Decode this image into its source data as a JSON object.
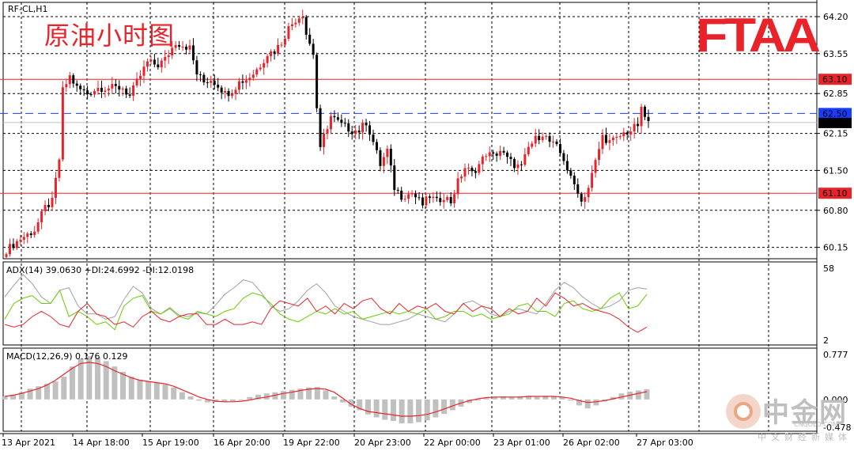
{
  "symbol_label": "RF-CL,H1",
  "title_cn": "原油小时图",
  "logo_text": "FTAA",
  "watermark": {
    "cn": "中金网",
    "url": "CNGOLD.COM",
    "sub": "中文财经新媒体"
  },
  "colors": {
    "red": "#e8242a",
    "blue": "#1a3cff",
    "green": "#66cc00",
    "gray": "#a0a0a0",
    "grid": "#000000"
  },
  "chart_data": [
    {
      "type": "candlestick",
      "name": "price",
      "ylim": [
        59.95,
        64.45
      ],
      "y_ticks": [
        "64.20",
        "63.55",
        "62.85",
        "62.15",
        "61.50",
        "60.80",
        "60.15"
      ],
      "y_tick_values": [
        64.2,
        63.55,
        62.85,
        62.15,
        61.5,
        60.8,
        60.15
      ],
      "x_ticks": [
        "13 Apr 2021",
        "14 Apr 18:00",
        "15 Apr 19:00",
        "16 Apr 20:00",
        "19 Apr 22:00",
        "20 Apr 23:00",
        "22 Apr 00:00",
        "23 Apr 01:00",
        "26 Apr 02:00",
        "27 Apr 03:00"
      ],
      "horizontal_lines": [
        {
          "value": 63.1,
          "label": "63.10",
          "style": "solid",
          "color": "#e8242a"
        },
        {
          "value": 62.5,
          "label": "62.50",
          "style": "dashed",
          "color": "#1a3cff"
        },
        {
          "value": 61.1,
          "label": "61.10",
          "style": "solid",
          "color": "#e8242a"
        }
      ],
      "current_price": {
        "value": 62.34,
        "label": "62.34"
      },
      "close_path": [
        [
          0,
          60.1
        ],
        [
          4,
          60.3
        ],
        [
          8,
          60.45
        ],
        [
          11,
          60.85
        ],
        [
          13,
          60.95
        ],
        [
          15,
          61.7
        ],
        [
          16,
          62.9
        ],
        [
          18,
          63.15
        ],
        [
          20,
          62.95
        ],
        [
          23,
          62.85
        ],
        [
          26,
          62.95
        ],
        [
          30,
          62.95
        ],
        [
          33,
          62.95
        ],
        [
          35,
          62.8
        ],
        [
          37,
          63.05
        ],
        [
          40,
          63.4
        ],
        [
          43,
          63.35
        ],
        [
          45,
          63.45
        ],
        [
          48,
          63.75
        ],
        [
          50,
          63.7
        ],
        [
          52,
          63.65
        ],
        [
          54,
          63.2
        ],
        [
          56,
          63.05
        ],
        [
          58,
          63.1
        ],
        [
          60,
          63.0
        ],
        [
          62,
          62.85
        ],
        [
          64,
          62.9
        ],
        [
          66,
          63.05
        ],
        [
          68,
          63.1
        ],
        [
          70,
          63.2
        ],
        [
          72,
          63.35
        ],
        [
          74,
          63.55
        ],
        [
          76,
          63.6
        ],
        [
          78,
          63.75
        ],
        [
          80,
          64.0
        ],
        [
          82,
          64.15
        ],
        [
          84,
          64.25
        ],
        [
          85,
          63.9
        ],
        [
          87,
          63.55
        ],
        [
          88,
          62.6
        ],
        [
          89,
          61.85
        ],
        [
          90,
          62.1
        ],
        [
          92,
          62.45
        ],
        [
          95,
          62.3
        ],
        [
          98,
          62.2
        ],
        [
          100,
          62.2
        ],
        [
          102,
          62.35
        ],
        [
          104,
          62.0
        ],
        [
          106,
          61.6
        ],
        [
          108,
          61.85
        ],
        [
          110,
          61.2
        ],
        [
          112,
          61.05
        ],
        [
          115,
          61.1
        ],
        [
          118,
          60.9
        ],
        [
          120,
          61.05
        ],
        [
          122,
          60.95
        ],
        [
          124,
          61.05
        ],
        [
          126,
          60.95
        ],
        [
          128,
          61.3
        ],
        [
          130,
          61.55
        ],
        [
          132,
          61.45
        ],
        [
          134,
          61.6
        ],
        [
          136,
          61.8
        ],
        [
          138,
          61.75
        ],
        [
          140,
          61.85
        ],
        [
          142,
          61.7
        ],
        [
          144,
          61.6
        ],
        [
          146,
          61.55
        ],
        [
          148,
          61.9
        ],
        [
          150,
          62.05
        ],
        [
          152,
          62.15
        ],
        [
          154,
          62.0
        ],
        [
          156,
          61.9
        ],
        [
          158,
          61.7
        ],
        [
          160,
          61.35
        ],
        [
          162,
          61.15
        ],
        [
          163,
          60.95
        ],
        [
          165,
          61.2
        ],
        [
          167,
          61.65
        ],
        [
          169,
          62.1
        ],
        [
          171,
          62.0
        ],
        [
          173,
          62.05
        ],
        [
          175,
          62.15
        ],
        [
          177,
          62.2
        ],
        [
          179,
          62.3
        ],
        [
          180,
          62.55
        ],
        [
          182,
          62.34
        ]
      ]
    },
    {
      "type": "line",
      "name": "ADX",
      "label": "ADX(14) 39.0630 +DI:24.6992 -DI:12.0198",
      "ylim": [
        2,
        58
      ],
      "y_ticks": [
        "58",
        "2"
      ],
      "series": [
        {
          "name": "ADX",
          "color": "#a0a0a0",
          "values": [
            35,
            44,
            52,
            45,
            35,
            30,
            40,
            42,
            28,
            22,
            22,
            18,
            20,
            33,
            43,
            38,
            26,
            22,
            27,
            21,
            20,
            23,
            22,
            29,
            37,
            42,
            48,
            46,
            38,
            28,
            24,
            26,
            32,
            40,
            45,
            38,
            28,
            24,
            20,
            18,
            16,
            14,
            14,
            16,
            18,
            22,
            20,
            18,
            16,
            22,
            30,
            32,
            28,
            22,
            20,
            24,
            26,
            24,
            22,
            30,
            40,
            46,
            42,
            35,
            30,
            26,
            28,
            32,
            40,
            42,
            41
          ]
        },
        {
          "name": "+DI",
          "color": "#66cc00",
          "values": [
            18,
            30,
            34,
            36,
            30,
            30,
            40,
            20,
            24,
            20,
            14,
            16,
            10,
            28,
            34,
            36,
            24,
            22,
            26,
            20,
            18,
            24,
            22,
            20,
            24,
            26,
            34,
            38,
            36,
            30,
            22,
            18,
            16,
            20,
            24,
            22,
            26,
            22,
            24,
            18,
            20,
            22,
            24,
            22,
            24,
            22,
            26,
            18,
            20,
            24,
            24,
            20,
            22,
            18,
            20,
            22,
            28,
            30,
            24,
            24,
            20,
            30,
            32,
            26,
            24,
            26,
            34,
            38,
            26,
            28,
            37
          ]
        },
        {
          "name": "-DI",
          "color": "#e8242a",
          "values": [
            14,
            12,
            14,
            20,
            24,
            20,
            14,
            12,
            24,
            30,
            22,
            20,
            14,
            16,
            12,
            20,
            24,
            18,
            16,
            20,
            22,
            22,
            14,
            14,
            18,
            14,
            14,
            16,
            14,
            26,
            32,
            30,
            28,
            34,
            24,
            28,
            22,
            30,
            26,
            32,
            34,
            26,
            22,
            30,
            24,
            28,
            26,
            30,
            24,
            22,
            30,
            24,
            28,
            26,
            20,
            26,
            22,
            24,
            34,
            28,
            38,
            34,
            28,
            30,
            26,
            24,
            22,
            18,
            12,
            8,
            12
          ]
        }
      ]
    },
    {
      "type": "bar",
      "name": "MACD",
      "label": "MACD(12,26,9) 0.176 0.129",
      "ylim": [
        -0.478,
        0.777
      ],
      "y_ticks": [
        "0.777",
        "0.000",
        "-0.478"
      ],
      "histogram": [
        0.05,
        0.08,
        0.12,
        0.18,
        0.22,
        0.26,
        0.3,
        0.38,
        0.55,
        0.68,
        0.72,
        0.7,
        0.64,
        0.55,
        0.46,
        0.38,
        0.33,
        0.3,
        0.28,
        0.25,
        0.2,
        0.12,
        0.05,
        -0.02,
        -0.05,
        -0.04,
        -0.04,
        -0.03,
        0.0,
        0.04,
        0.08,
        0.1,
        0.12,
        0.14,
        0.16,
        0.18,
        0.2,
        0.21,
        0.15,
        0.05,
        -0.05,
        -0.12,
        -0.18,
        -0.25,
        -0.3,
        -0.34,
        -0.36,
        -0.4,
        -0.4,
        -0.38,
        -0.35,
        -0.3,
        -0.24,
        -0.18,
        -0.12,
        -0.06,
        -0.02,
        0.02,
        0.04,
        0.05,
        0.04,
        0.05,
        0.06,
        0.04,
        0.06,
        0.05,
        0.04,
        -0.02,
        -0.1,
        -0.15,
        -0.1,
        -0.03,
        0.04,
        0.1,
        0.13,
        0.15,
        0.17
      ],
      "signal": [
        0.05,
        0.07,
        0.1,
        0.14,
        0.18,
        0.24,
        0.32,
        0.42,
        0.52,
        0.6,
        0.62,
        0.6,
        0.55,
        0.48,
        0.42,
        0.36,
        0.32,
        0.3,
        0.28,
        0.26,
        0.22,
        0.16,
        0.1,
        0.04,
        0.0,
        -0.03,
        -0.04,
        -0.04,
        -0.03,
        -0.01,
        0.02,
        0.04,
        0.07,
        0.1,
        0.12,
        0.15,
        0.17,
        0.18,
        0.17,
        0.12,
        0.02,
        -0.08,
        -0.15,
        -0.2,
        -0.22,
        -0.24,
        -0.26,
        -0.28,
        -0.28,
        -0.27,
        -0.25,
        -0.21,
        -0.16,
        -0.11,
        -0.06,
        -0.02,
        0.01,
        0.03,
        0.04,
        0.04,
        0.04,
        0.04,
        0.05,
        0.05,
        0.05,
        0.05,
        0.04,
        0.02,
        -0.02,
        -0.05,
        -0.04,
        -0.02,
        0.01,
        0.04,
        0.07,
        0.1,
        0.13
      ]
    }
  ]
}
